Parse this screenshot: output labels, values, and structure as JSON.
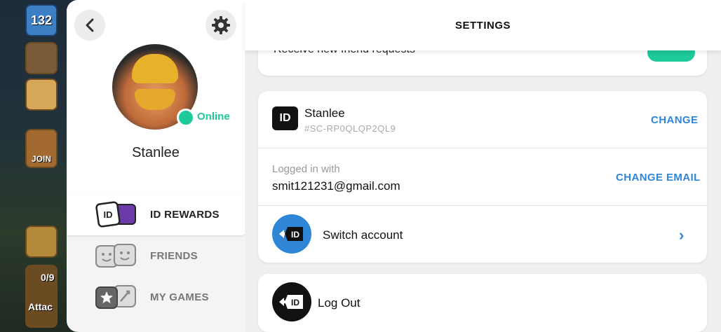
{
  "game": {
    "level": "132",
    "join_label": "JOIN",
    "attack_label": "Attac",
    "trophies": "0/9"
  },
  "sidebar": {
    "online_label": "Online",
    "username": "Stanlee",
    "items": [
      {
        "label": "ID REWARDS",
        "icon": "id-rewards-icon",
        "active": true
      },
      {
        "label": "FRIENDS",
        "icon": "friends-icon",
        "active": false
      },
      {
        "label": "MY GAMES",
        "icon": "my-games-icon",
        "active": false
      }
    ]
  },
  "header": {
    "title": "SETTINGS"
  },
  "friend_requests": {
    "label": "Receive new friend requests",
    "enabled": true
  },
  "account": {
    "badge": "ID",
    "name": "Stanlee",
    "tag": "#SC-RP0QLQP2QL9",
    "change_label": "CHANGE",
    "logged_in_label": "Logged in with",
    "email": "smit121231@gmail.com",
    "change_email_label": "CHANGE EMAIL",
    "switch_label": "Switch account"
  },
  "logout": {
    "label": "Log Out"
  },
  "colors": {
    "accent_blue": "#2f86d6",
    "online_green": "#1ec99a"
  }
}
